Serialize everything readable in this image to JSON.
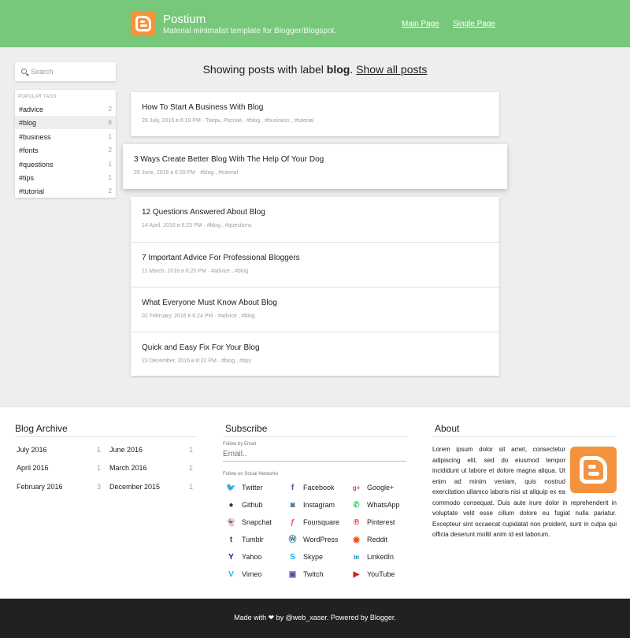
{
  "header": {
    "title": "Postium",
    "description": "Material minimalist template for Blogger/Blogspot.",
    "nav": [
      "Main Page",
      "Single Page"
    ]
  },
  "sidebar": {
    "search_placeholder": "Search",
    "tags_title": "POPULAR TAGS",
    "tags": [
      {
        "name": "#advice",
        "count": "2"
      },
      {
        "name": "#blog",
        "count": "6"
      },
      {
        "name": "#business",
        "count": "1"
      },
      {
        "name": "#fonts",
        "count": "2"
      },
      {
        "name": "#questions",
        "count": "1"
      },
      {
        "name": "#tips",
        "count": "1"
      },
      {
        "name": "#tutorial",
        "count": "2"
      }
    ]
  },
  "main": {
    "showing_prefix": "Showing posts with label ",
    "label": "blog",
    "showing_suffix": ". ",
    "show_all": "Show all posts",
    "posts": [
      {
        "title": "How To Start A Business With Blog",
        "meta": "28 July, 2016 в 6:19 PM · Тверь, Россия · #blog , #business , #tutorial"
      },
      {
        "title": "3 Ways Create Better Blog With The Help Of Your Dog",
        "meta": "29 June, 2016 в 6:20 PM · #blog , #tutorial"
      },
      {
        "title": "12 Questions Answered About Blog",
        "meta": "14 April, 2016 в 6:23 PM · #blog , #questions"
      },
      {
        "title": "7 Important Advice For Professional Bloggers",
        "meta": "11 March, 2016 в 6:20 PM · #advice , #blog"
      },
      {
        "title": "What Everyone Must Know About Blog",
        "meta": "02 February, 2016 в 6:24 PM · #advice , #blog"
      },
      {
        "title": "Quick and Easy Fix For Your Blog",
        "meta": "23 December, 2015 в 6:22 PM · #blog , #tips"
      }
    ]
  },
  "archive": {
    "title": "Blog Archive",
    "items": [
      {
        "month": "July 2016",
        "count": "1"
      },
      {
        "month": "June 2016",
        "count": "1"
      },
      {
        "month": "April 2016",
        "count": "1"
      },
      {
        "month": "March 2016",
        "count": "1"
      },
      {
        "month": "February 2016",
        "count": "3"
      },
      {
        "month": "December 2015",
        "count": "1"
      }
    ]
  },
  "subscribe": {
    "title": "Subscribe",
    "email_label": "Follow by Email",
    "email_placeholder": "Email..",
    "social_label": "Follow on Social Networks",
    "networks": [
      {
        "name": "Twitter",
        "icon": "twitter-icon",
        "glyph": "🐦",
        "color": "#1da1f2"
      },
      {
        "name": "Facebook",
        "icon": "facebook-icon",
        "glyph": "f",
        "color": "#3b5998"
      },
      {
        "name": "Google+",
        "icon": "google-plus-icon",
        "glyph": "g+",
        "color": "#dd4b39"
      },
      {
        "name": "Github",
        "icon": "github-icon",
        "glyph": "●",
        "color": "#333333"
      },
      {
        "name": "Instagram",
        "icon": "instagram-icon",
        "glyph": "◙",
        "color": "#3f729b"
      },
      {
        "name": "WhatsApp",
        "icon": "whatsapp-icon",
        "glyph": "✆",
        "color": "#25d366"
      },
      {
        "name": "Snapchat",
        "icon": "snapchat-icon",
        "glyph": "👻",
        "color": "#fffc00"
      },
      {
        "name": "Foursquare",
        "icon": "foursquare-icon",
        "glyph": "ƒ",
        "color": "#f94877"
      },
      {
        "name": "Pinterest",
        "icon": "pinterest-icon",
        "glyph": "℗",
        "color": "#cb2027"
      },
      {
        "name": "Tumblr",
        "icon": "tumblr-icon",
        "glyph": "t",
        "color": "#35465c"
      },
      {
        "name": "WordPress",
        "icon": "wordpress-icon",
        "glyph": "Ⓦ",
        "color": "#21759b"
      },
      {
        "name": "Reddit",
        "icon": "reddit-icon",
        "glyph": "◉",
        "color": "#ff4500"
      },
      {
        "name": "Yahoo",
        "icon": "yahoo-icon",
        "glyph": "Y",
        "color": "#410093"
      },
      {
        "name": "Skype",
        "icon": "skype-icon",
        "glyph": "S",
        "color": "#00aff0"
      },
      {
        "name": "LinkedIn",
        "icon": "linkedin-icon",
        "glyph": "in",
        "color": "#0077b5"
      },
      {
        "name": "Vimeo",
        "icon": "vimeo-icon",
        "glyph": "V",
        "color": "#1ab7ea"
      },
      {
        "name": "Twitch",
        "icon": "twitch-icon",
        "glyph": "▣",
        "color": "#6441a5"
      },
      {
        "name": "YouTube",
        "icon": "youtube-icon",
        "glyph": "▶",
        "color": "#cd201f"
      }
    ]
  },
  "about": {
    "title": "About",
    "text": "Lorem ipsum dolor sit amet, consectetur adipiscing elit, sed do eiusmod tempor incididunt ut labore et dolore magna aliqua. Ut enim ad minim veniam, quis nostrud exercitation ullamco laboris nisi ut aliquip ex ea commodo consequat. Duis aute irure dolor in reprehenderit in voluptate velit esse cillum dolore eu fugiat nulla pariatur. Excepteur sint occaecat cupidatat non proident, sunt in culpa qui officia deserunt mollit anim id est laborum."
  },
  "footer": {
    "text": "Made with ❤ by @web_xaser. Powered by Blogger."
  },
  "colors": {
    "header_bg": "#78c87b",
    "logo_bg": "#f5923e",
    "footer_bg": "#212121"
  }
}
